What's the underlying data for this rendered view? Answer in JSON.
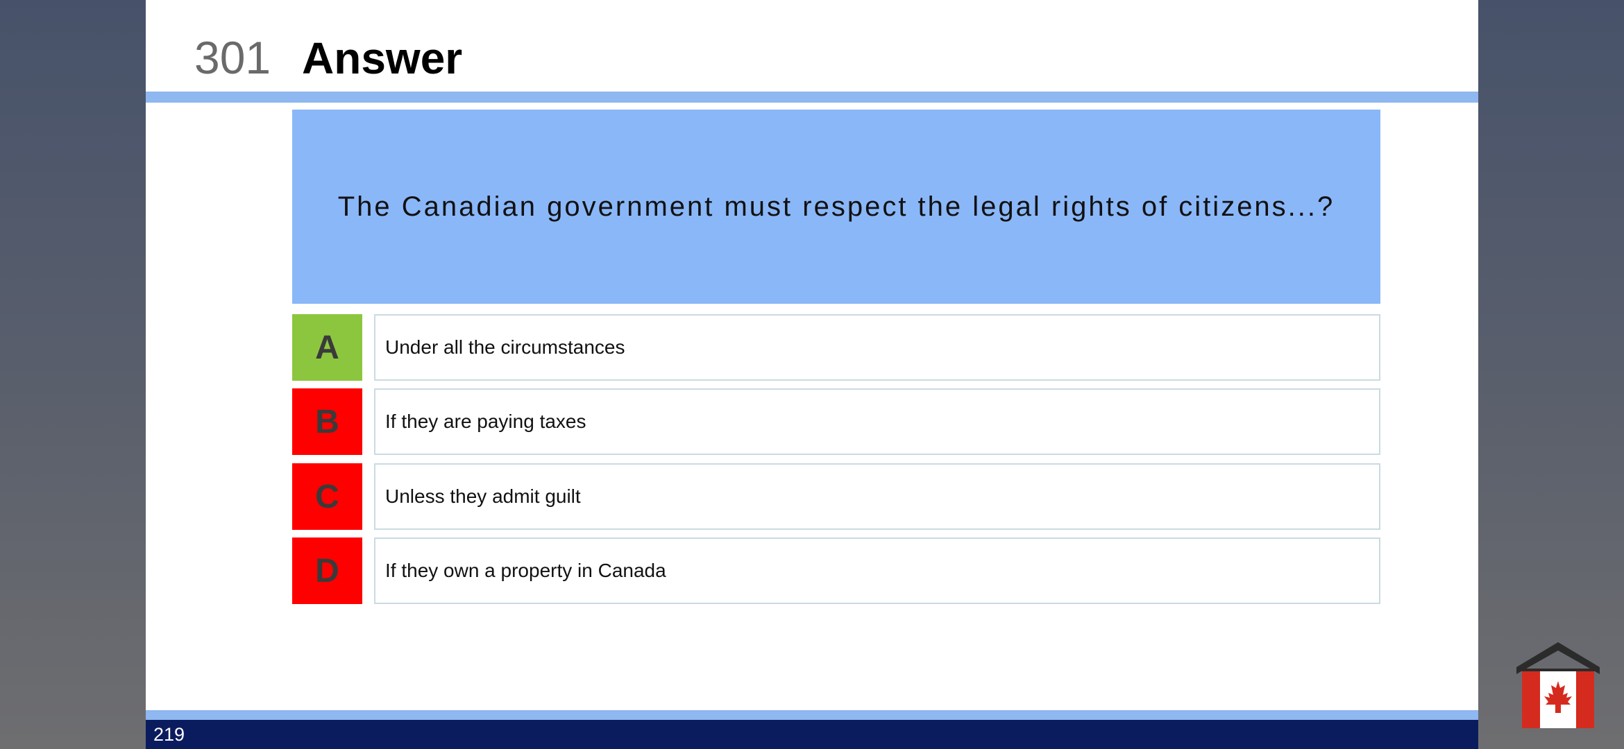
{
  "slide": {
    "number": "301",
    "title": "Answer",
    "question": "The Canadian government must respect the legal rights of citizens...?",
    "answers": [
      {
        "letter": "A",
        "text": "Under all the circumstances",
        "status": "correct"
      },
      {
        "letter": "B",
        "text": "If they are paying taxes",
        "status": "incorrect"
      },
      {
        "letter": "C",
        "text": "Unless they admit guilt",
        "status": "incorrect"
      },
      {
        "letter": "D",
        "text": "If they own a property in Canada",
        "status": "incorrect"
      }
    ],
    "page_number": "219"
  },
  "colors": {
    "correct": "#8cc63f",
    "incorrect": "#ff0000",
    "question_bg": "#8ab7f7",
    "rule": "#8fb7f0",
    "footer": "#0b1c5e"
  },
  "logo": {
    "icon": "house-with-canadian-flag-icon"
  }
}
